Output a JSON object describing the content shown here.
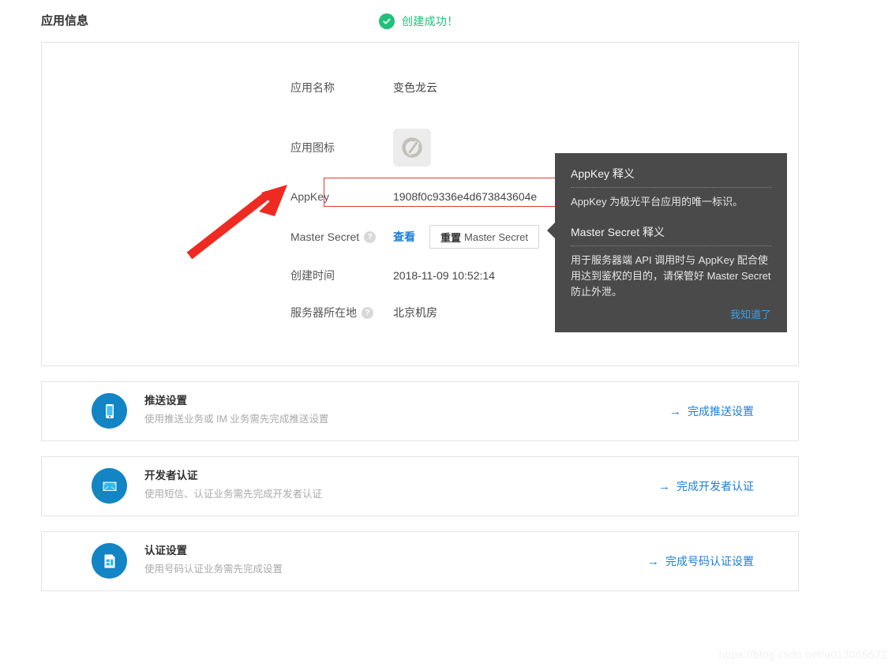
{
  "header": {
    "title": "应用信息",
    "status_text": "创建成功！",
    "status_icon": "check-circle-icon",
    "status_color": "#22c07a"
  },
  "app_info": {
    "fields": [
      {
        "label": "应用名称",
        "value": "变色龙云",
        "help": false
      },
      {
        "label": "应用图标",
        "value": "",
        "help": false,
        "icon": "app-logo-icon"
      },
      {
        "label": "AppKey",
        "value": "1908f0c9336e4d673843604e",
        "help": false,
        "highlight": true
      },
      {
        "label": "Master Secret",
        "value": "",
        "help": true
      },
      {
        "label": "创建时间",
        "value": "2018-11-09 10:52:14",
        "help": false
      },
      {
        "label": "服务器所在地",
        "value": "北京机房",
        "help": true
      }
    ],
    "view_link": "查看",
    "reset_button_strong": "重置",
    "reset_button_rest": "Master Secret",
    "help_badge_glyph": "?",
    "highlight_color": "#e03a32"
  },
  "tooltip": {
    "heading1": "AppKey 释义",
    "body1": "AppKey 为极光平台应用的唯一标识。",
    "heading2": "Master Secret 释义",
    "body2": "用于服务器端 API 调用时与 AppKey 配合使用达到鉴权的目的，请保管好 Master Secret 防止外泄。",
    "dismiss": "我知道了",
    "background": "#4a4a4a",
    "link_color": "#3ba0e8"
  },
  "tasks": [
    {
      "icon": "mobile-phone-icon",
      "title": "推送设置",
      "desc": "使用推送业务或 IM 业务需先完成推送设置",
      "action": "完成推送设置",
      "action_arrow": "→"
    },
    {
      "icon": "envelope-icon",
      "title": "开发者认证",
      "desc": "使用短信、认证业务需先完成开发者认证",
      "action": "完成开发者认证",
      "action_arrow": "→"
    },
    {
      "icon": "sim-card-icon",
      "title": "认证设置",
      "desc": "使用号码认证业务需先完成设置",
      "action": "完成号码认证设置",
      "action_arrow": "→"
    }
  ],
  "watermark": "https://blog.csdn.net/u013065572",
  "annotation": {
    "type": "red-arrow",
    "color": "#ee2b22",
    "points_to": "AppKey"
  }
}
